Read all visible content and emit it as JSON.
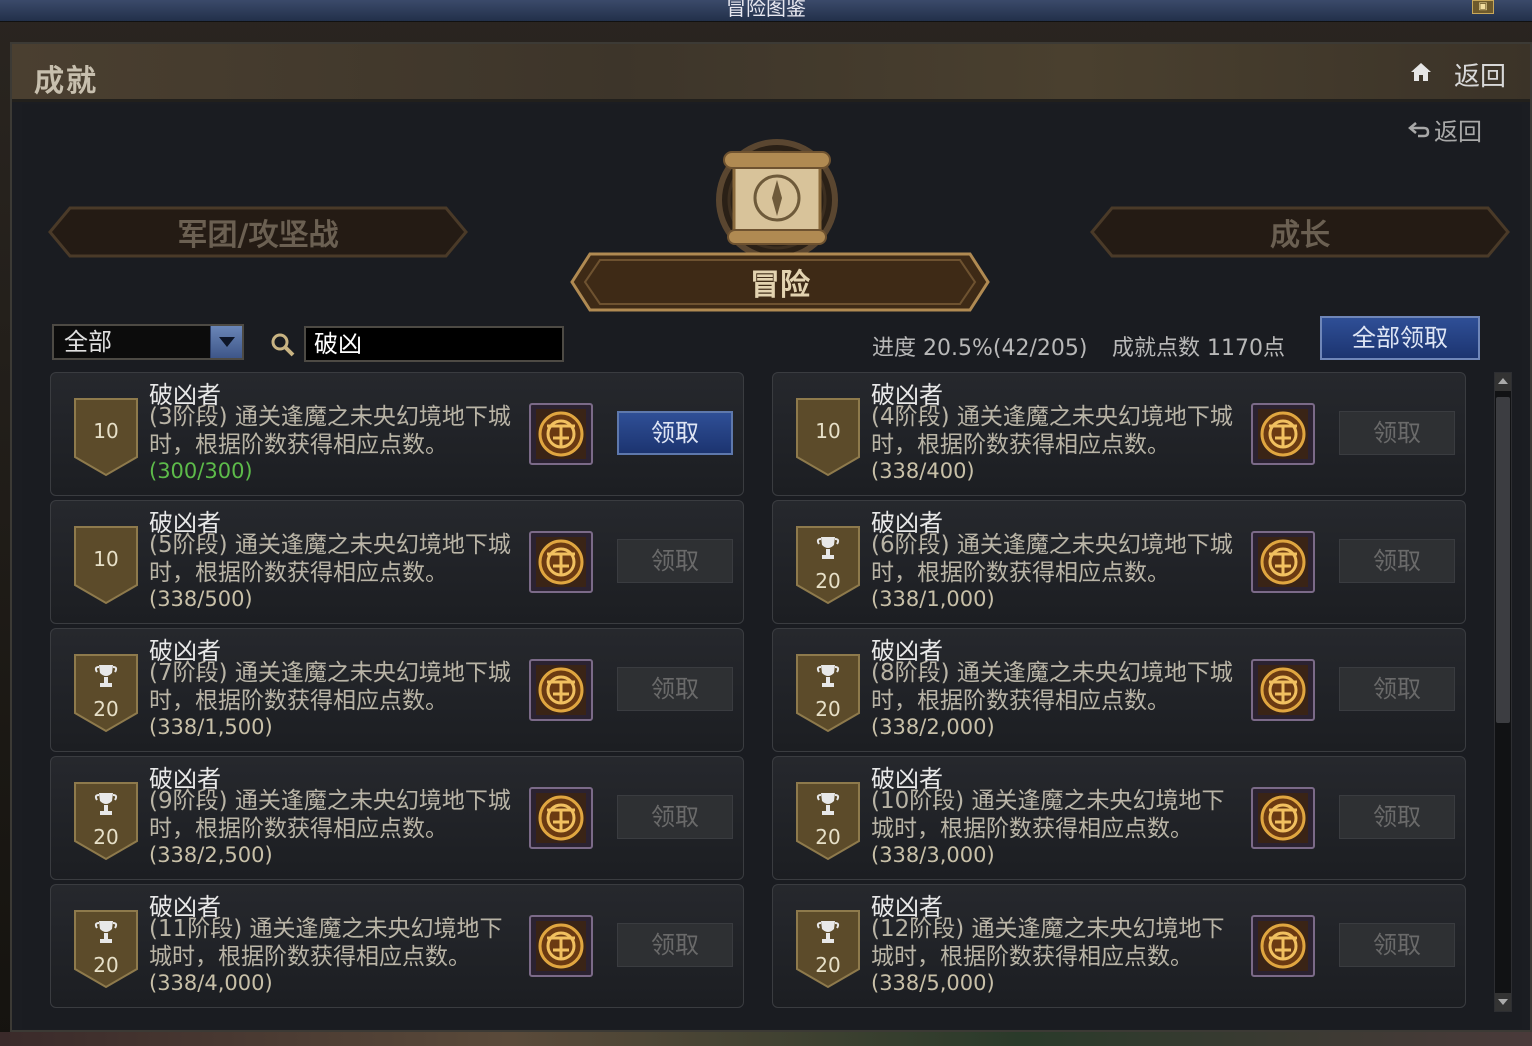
{
  "titlebar": {
    "title": "冒险图鉴"
  },
  "header": {
    "title": "成就",
    "back_label": "返回"
  },
  "subnav": {
    "back_label": "返回"
  },
  "tabs": {
    "left": "军团/攻坚战",
    "center": "冒险",
    "right": "成长"
  },
  "filter": {
    "selected": "全部"
  },
  "search": {
    "value": "破凶"
  },
  "summary": {
    "progress": "进度 20.5%(42/205)",
    "points": "成就点数 1170点",
    "claim_all_label": "全部领取"
  },
  "achievements": [
    {
      "title": "破凶者",
      "desc": "(3阶段) 通关逢魔之未央幻境地下城时，根据阶数获得相应点数。",
      "progress": "(300/300)",
      "points": "10",
      "trophy": false,
      "completed": true,
      "button": "领取",
      "button_enabled": true
    },
    {
      "title": "破凶者",
      "desc": "(4阶段) 通关逢魔之未央幻境地下城时，根据阶数获得相应点数。",
      "progress": "(338/400)",
      "points": "10",
      "trophy": false,
      "completed": false,
      "button": "领取",
      "button_enabled": false
    },
    {
      "title": "破凶者",
      "desc": "(5阶段) 通关逢魔之未央幻境地下城时，根据阶数获得相应点数。",
      "progress": "(338/500)",
      "points": "10",
      "trophy": false,
      "completed": false,
      "button": "领取",
      "button_enabled": false
    },
    {
      "title": "破凶者",
      "desc": "(6阶段) 通关逢魔之未央幻境地下城时，根据阶数获得相应点数。",
      "progress": "(338/1,000)",
      "points": "20",
      "trophy": true,
      "completed": false,
      "button": "领取",
      "button_enabled": false
    },
    {
      "title": "破凶者",
      "desc": "(7阶段) 通关逢魔之未央幻境地下城时，根据阶数获得相应点数。",
      "progress": "(338/1,500)",
      "points": "20",
      "trophy": true,
      "completed": false,
      "button": "领取",
      "button_enabled": false
    },
    {
      "title": "破凶者",
      "desc": "(8阶段) 通关逢魔之未央幻境地下城时，根据阶数获得相应点数。",
      "progress": "(338/2,000)",
      "points": "20",
      "trophy": true,
      "completed": false,
      "button": "领取",
      "button_enabled": false
    },
    {
      "title": "破凶者",
      "desc": "(9阶段) 通关逢魔之未央幻境地下城时，根据阶数获得相应点数。",
      "progress": "(338/2,500)",
      "points": "20",
      "trophy": true,
      "completed": false,
      "button": "领取",
      "button_enabled": false
    },
    {
      "title": "破凶者",
      "desc": "(10阶段) 通关逢魔之未央幻境地下城时，根据阶数获得相应点数。",
      "progress": "(338/3,000)",
      "points": "20",
      "trophy": true,
      "completed": false,
      "button": "领取",
      "button_enabled": false
    },
    {
      "title": "破凶者",
      "desc": "(11阶段) 通关逢魔之未央幻境地下城时，根据阶数获得相应点数。",
      "progress": "(338/4,000)",
      "points": "20",
      "trophy": true,
      "completed": false,
      "button": "领取",
      "button_enabled": false
    },
    {
      "title": "破凶者",
      "desc": "(12阶段) 通关逢魔之未央幻境地下城时，根据阶数获得相应点数。",
      "progress": "(338/5,000)",
      "points": "20",
      "trophy": true,
      "completed": false,
      "button": "领取",
      "button_enabled": false
    }
  ],
  "colors": {
    "accent_blue": "#2f4f96",
    "progress_done": "#5dbb4a",
    "badge_gold": "#6b5a34"
  },
  "icons": {
    "home": "home-icon",
    "back": "back-arrow-icon",
    "search": "search-icon",
    "trophy": "trophy-icon",
    "reward": "achievement-emblem-icon",
    "scroll": "scroll-compass-icon"
  }
}
